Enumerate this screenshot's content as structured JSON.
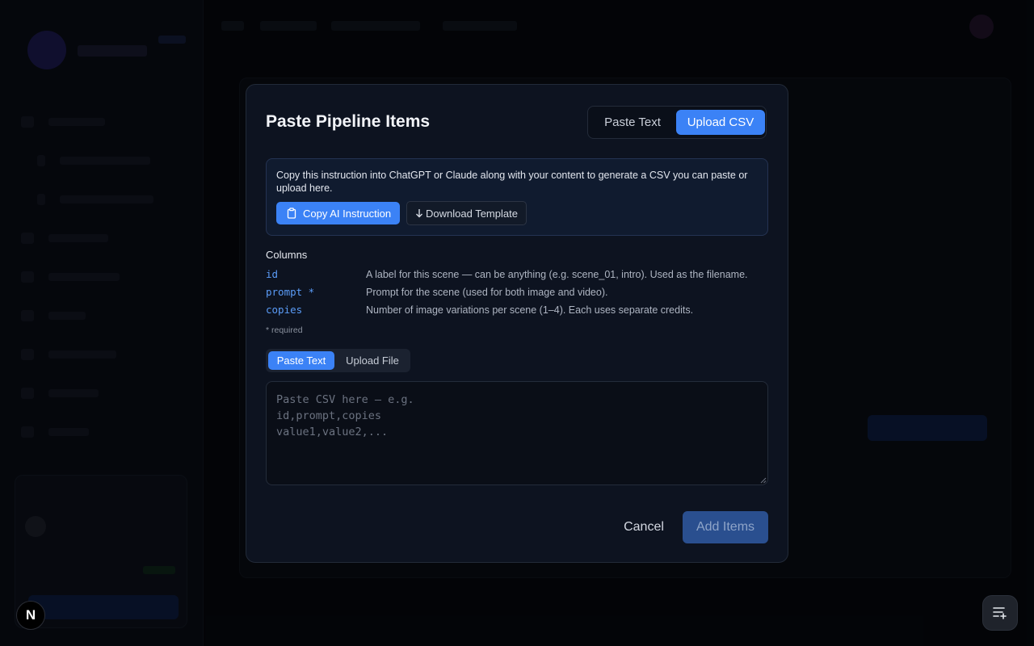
{
  "modal": {
    "title": "Paste Pipeline Items",
    "mode_tabs": [
      {
        "label": "Paste Text",
        "active": false
      },
      {
        "label": "Upload CSV",
        "active": true
      }
    ],
    "info": {
      "text": "Copy this instruction into ChatGPT or Claude along with your content to generate a CSV you can paste or upload here.",
      "copy_button": "Copy AI Instruction",
      "download_button": "Download Template",
      "copy_icon": "clipboard-icon",
      "download_icon": "arrow-down-icon"
    },
    "columns_heading": "Columns",
    "columns": [
      {
        "key": "id",
        "description": "A label for this scene — can be anything (e.g. scene_01, intro). Used as the filename."
      },
      {
        "key": "prompt *",
        "description": "Prompt for the scene (used for both image and video)."
      },
      {
        "key": "copies",
        "description": "Number of image variations per scene (1–4). Each uses separate credits."
      }
    ],
    "required_note": "* required",
    "input_tabs": [
      {
        "label": "Paste Text",
        "active": true
      },
      {
        "label": "Upload File",
        "active": false
      }
    ],
    "csv_placeholder": "Paste CSV here — e.g.\nid,prompt,copies\nvalue1,value2,...",
    "cancel_button": "Cancel",
    "add_button": "Add Items"
  },
  "colors": {
    "accent": "#3b82f6",
    "modal_bg": "#0d1320",
    "page_bg": "#05070c",
    "column_key": "#5b9cf8"
  },
  "corner_badges": {
    "next_badge": "N",
    "fab_icon": "playlist-add-icon"
  }
}
